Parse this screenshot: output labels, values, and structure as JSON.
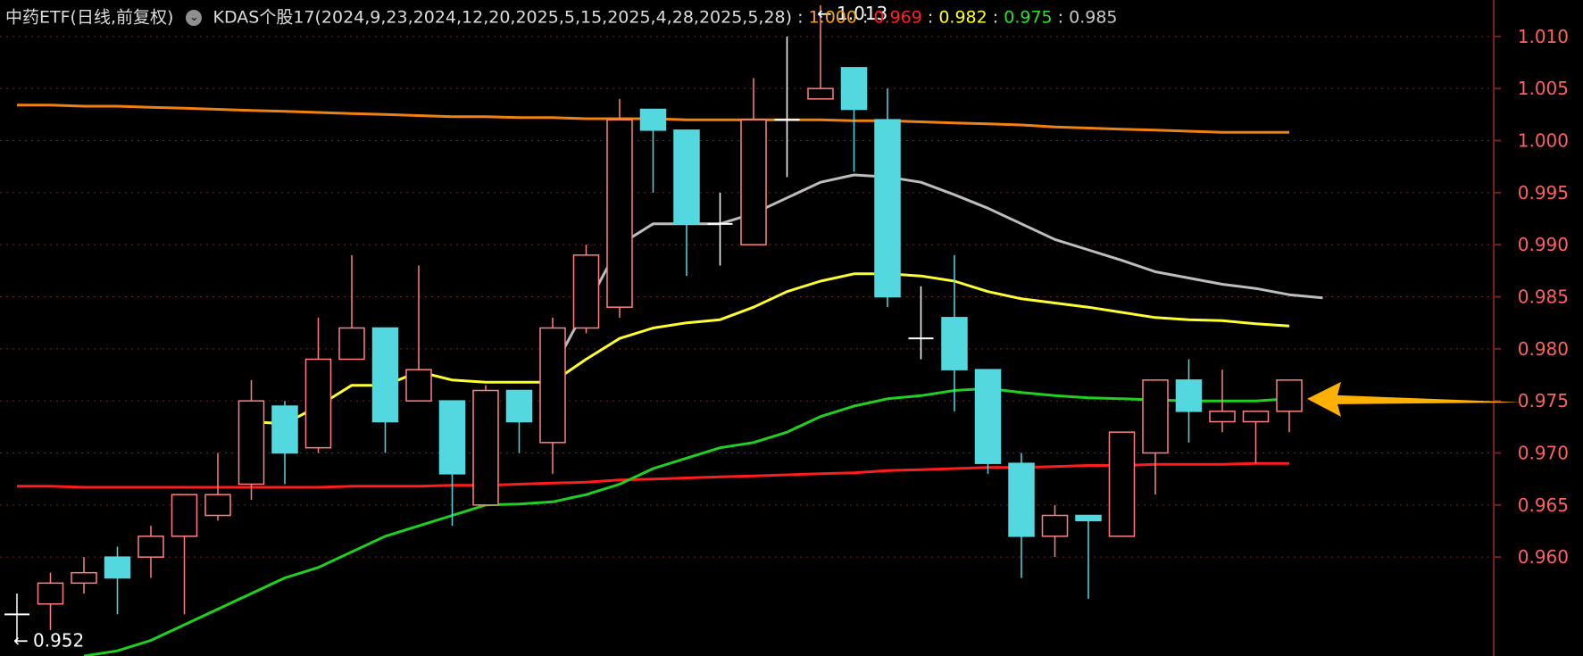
{
  "legend": {
    "instrument": "中药ETF(日线,前复权)",
    "dropdown_icon": "chevron-down-circle-icon",
    "indicator": "KDAS个股17(2024,9,23,2024,12,20,2025,5,15,2025,4,28,2025,5,28)",
    "values": [
      {
        "text": "1.000",
        "color": "#f0a020"
      },
      {
        "text": "0.969",
        "color": "#ff2020"
      },
      {
        "text": "0.982",
        "color": "#ffff20"
      },
      {
        "text": "0.975",
        "color": "#30e030"
      },
      {
        "text": "0.985",
        "color": "#c8c8c8"
      }
    ]
  },
  "colors": {
    "up": "#ff8080",
    "down": "#54d8e0",
    "axis_text": "#ff6060",
    "grid": "#7a1f1f",
    "orange_line": "#f08010",
    "red_line": "#ff1c1c",
    "yellow_line": "#ffff30",
    "green_line": "#20d020",
    "gray_line": "#bdbdbd",
    "arrow": "#ffb000"
  },
  "chart_data": {
    "type": "candlestick",
    "ylim": [
      0.9505,
      1.0135
    ],
    "y_ticks": [
      "1.010",
      "1.005",
      "1.000",
      "0.995",
      "0.990",
      "0.985",
      "0.980",
      "0.975",
      "0.970",
      "0.965",
      "0.960"
    ],
    "candles": [
      {
        "o": 0.9545,
        "h": 0.9565,
        "l": 0.952,
        "c": 0.9545
      },
      {
        "o": 0.9555,
        "h": 0.9585,
        "l": 0.953,
        "c": 0.9575
      },
      {
        "o": 0.9575,
        "h": 0.96,
        "l": 0.9565,
        "c": 0.9585
      },
      {
        "o": 0.96,
        "h": 0.961,
        "l": 0.9545,
        "c": 0.958
      },
      {
        "o": 0.96,
        "h": 0.963,
        "l": 0.958,
        "c": 0.962
      },
      {
        "o": 0.962,
        "h": 0.966,
        "l": 0.9545,
        "c": 0.966
      },
      {
        "o": 0.964,
        "h": 0.97,
        "l": 0.9635,
        "c": 0.966
      },
      {
        "o": 0.967,
        "h": 0.977,
        "l": 0.9655,
        "c": 0.975
      },
      {
        "o": 0.9745,
        "h": 0.975,
        "l": 0.967,
        "c": 0.97
      },
      {
        "o": 0.9705,
        "h": 0.983,
        "l": 0.97,
        "c": 0.979
      },
      {
        "o": 0.979,
        "h": 0.989,
        "l": 0.979,
        "c": 0.982
      },
      {
        "o": 0.982,
        "h": 0.982,
        "l": 0.97,
        "c": 0.973
      },
      {
        "o": 0.975,
        "h": 0.988,
        "l": 0.975,
        "c": 0.978
      },
      {
        "o": 0.975,
        "h": 0.975,
        "l": 0.963,
        "c": 0.968
      },
      {
        "o": 0.965,
        "h": 0.9765,
        "l": 0.965,
        "c": 0.976
      },
      {
        "o": 0.976,
        "h": 0.976,
        "l": 0.97,
        "c": 0.973
      },
      {
        "o": 0.971,
        "h": 0.983,
        "l": 0.968,
        "c": 0.982
      },
      {
        "o": 0.982,
        "h": 0.99,
        "l": 0.9815,
        "c": 0.989
      },
      {
        "o": 0.984,
        "h": 1.004,
        "l": 0.983,
        "c": 1.002
      },
      {
        "o": 1.003,
        "h": 1.003,
        "l": 0.995,
        "c": 1.001
      },
      {
        "o": 1.001,
        "h": 1.001,
        "l": 0.987,
        "c": 0.992
      },
      {
        "o": 0.992,
        "h": 0.995,
        "l": 0.988,
        "c": 0.992
      },
      {
        "o": 0.99,
        "h": 1.006,
        "l": 0.99,
        "c": 1.002
      },
      {
        "o": 1.002,
        "h": 1.01,
        "l": 0.9965,
        "c": 1.002
      },
      {
        "o": 1.004,
        "h": 1.013,
        "l": 1.004,
        "c": 1.005
      },
      {
        "o": 1.007,
        "h": 1.007,
        "l": 0.997,
        "c": 1.003
      },
      {
        "o": 1.002,
        "h": 1.005,
        "l": 0.984,
        "c": 0.985
      },
      {
        "o": 0.981,
        "h": 0.986,
        "l": 0.979,
        "c": 0.981
      },
      {
        "o": 0.983,
        "h": 0.989,
        "l": 0.974,
        "c": 0.978
      },
      {
        "o": 0.978,
        "h": 0.978,
        "l": 0.968,
        "c": 0.969
      },
      {
        "o": 0.969,
        "h": 0.97,
        "l": 0.958,
        "c": 0.962
      },
      {
        "o": 0.962,
        "h": 0.965,
        "l": 0.96,
        "c": 0.964
      },
      {
        "o": 0.964,
        "h": 0.964,
        "l": 0.956,
        "c": 0.9635
      },
      {
        "o": 0.962,
        "h": 0.972,
        "l": 0.962,
        "c": 0.972
      },
      {
        "o": 0.97,
        "h": 0.977,
        "l": 0.966,
        "c": 0.977
      },
      {
        "o": 0.977,
        "h": 0.979,
        "l": 0.971,
        "c": 0.974
      },
      {
        "o": 0.973,
        "h": 0.978,
        "l": 0.972,
        "c": 0.974
      },
      {
        "o": 0.973,
        "h": 0.974,
        "l": 0.969,
        "c": 0.974
      },
      {
        "o": 0.974,
        "h": 0.977,
        "l": 0.972,
        "c": 0.977
      }
    ],
    "lines": [
      {
        "color_key": "orange_line",
        "start": 0,
        "values": [
          1.0034,
          1.0034,
          1.0033,
          1.0033,
          1.0032,
          1.0031,
          1.003,
          1.0029,
          1.0028,
          1.0027,
          1.0026,
          1.0025,
          1.0024,
          1.0023,
          1.0023,
          1.0022,
          1.0022,
          1.0021,
          1.0021,
          1.0021,
          1.002,
          1.002,
          1.002,
          1.002,
          1.002,
          1.0019,
          1.0019,
          1.0018,
          1.0017,
          1.0016,
          1.0015,
          1.0013,
          1.0012,
          1.0011,
          1.001,
          1.0009,
          1.0008,
          1.0008,
          1.0008
        ]
      },
      {
        "color_key": "red_line",
        "start": 0,
        "values": [
          0.9668,
          0.9668,
          0.9667,
          0.9667,
          0.9667,
          0.9667,
          0.9667,
          0.9667,
          0.9667,
          0.9667,
          0.9668,
          0.9668,
          0.9668,
          0.9669,
          0.9669,
          0.967,
          0.9671,
          0.9672,
          0.9674,
          0.9675,
          0.9676,
          0.9677,
          0.9678,
          0.9679,
          0.968,
          0.9681,
          0.9683,
          0.9684,
          0.9685,
          0.9686,
          0.9686,
          0.9687,
          0.9688,
          0.9688,
          0.9689,
          0.9689,
          0.9689,
          0.969,
          0.969
        ]
      },
      {
        "color_key": "yellow_line",
        "start": 7,
        "values": [
          0.973,
          0.9728,
          0.9745,
          0.9765,
          0.9765,
          0.9778,
          0.977,
          0.9768,
          0.9768,
          0.9768,
          0.979,
          0.981,
          0.982,
          0.9825,
          0.9828,
          0.984,
          0.9855,
          0.9865,
          0.9872,
          0.9872,
          0.987,
          0.9865,
          0.9855,
          0.9848,
          0.9844,
          0.984,
          0.9835,
          0.983,
          0.9828,
          0.9827,
          0.9824,
          0.9822
        ]
      },
      {
        "color_key": "green_line",
        "start": 2,
        "values": [
          0.9505,
          0.951,
          0.952,
          0.9535,
          0.955,
          0.9565,
          0.958,
          0.959,
          0.9605,
          0.962,
          0.963,
          0.964,
          0.965,
          0.9651,
          0.9653,
          0.966,
          0.967,
          0.9685,
          0.9695,
          0.9705,
          0.971,
          0.972,
          0.9735,
          0.9745,
          0.9752,
          0.9755,
          0.976,
          0.9762,
          0.9758,
          0.9755,
          0.9753,
          0.9752,
          0.9751,
          0.975,
          0.975,
          0.975,
          0.9752
        ]
      },
      {
        "color_key": "gray_line",
        "start": 16,
        "values": [
          0.978,
          0.984,
          0.99,
          0.992,
          0.992,
          0.992,
          0.993,
          0.9945,
          0.996,
          0.9967,
          0.9965,
          0.996,
          0.9948,
          0.9935,
          0.992,
          0.9905,
          0.9895,
          0.9885,
          0.9874,
          0.9868,
          0.9862,
          0.9858,
          0.9852,
          0.9849
        ]
      }
    ],
    "annotations": {
      "high_label": "1.013",
      "low_label": "0.952",
      "high_arrow_icon": "arrow-left-icon",
      "low_arrow_icon": "arrow-left-icon",
      "pointer_icon": "arrow-left-icon"
    }
  }
}
